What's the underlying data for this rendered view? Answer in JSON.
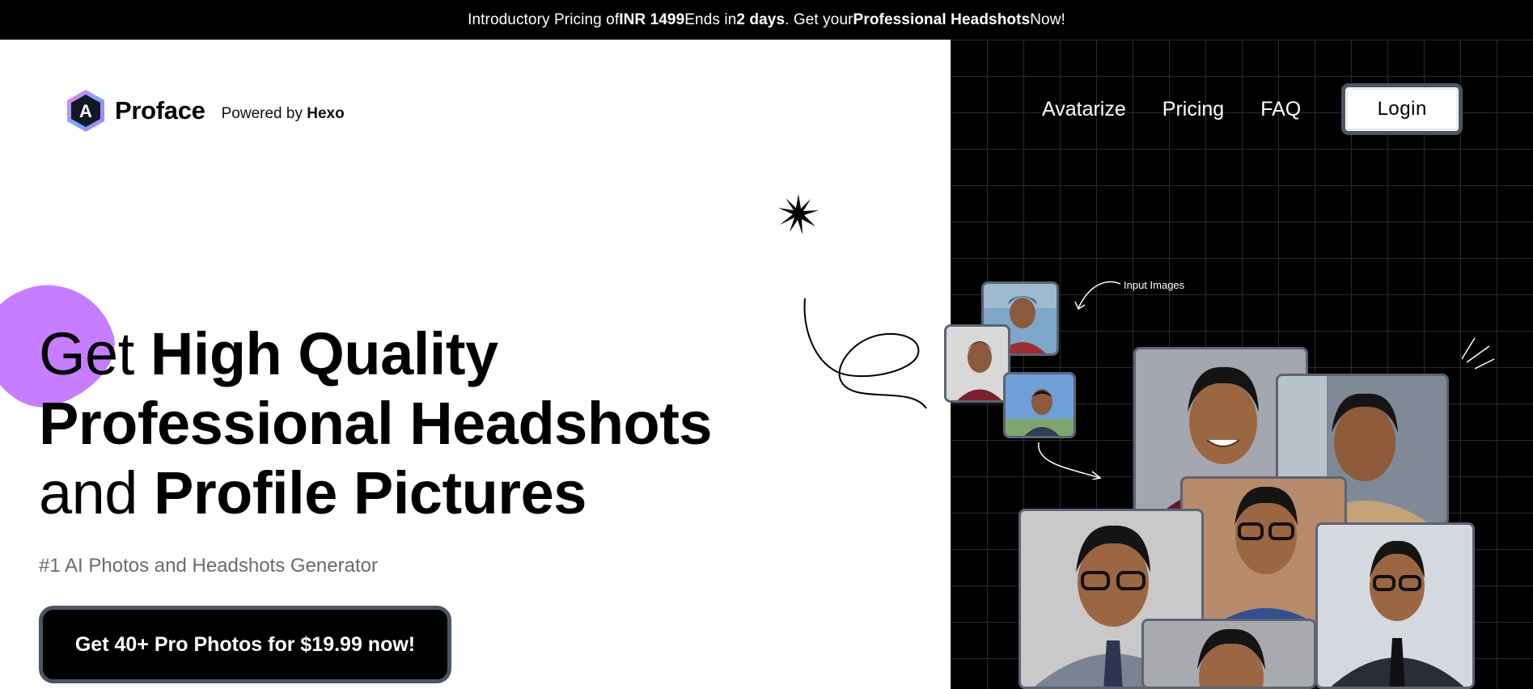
{
  "announcement": {
    "prefix": "Introductory Pricing of ",
    "price": "INR 1499",
    "middle": " Ends in ",
    "days": "2 days",
    "middle2": ". Get your ",
    "product": "Professional Headshots",
    "suffix": " Now!"
  },
  "brand": {
    "logo_letter": "A",
    "name": "Proface",
    "powered_prefix": "Powered by ",
    "powered_name": "Hexo"
  },
  "nav": {
    "items": [
      "Avatarize",
      "Pricing",
      "FAQ"
    ],
    "login_label": "Login"
  },
  "hero": {
    "line1_light": "Get ",
    "line1_bold": "High Quality",
    "line2_bold": "Professional Headshots",
    "line3_light": "and ",
    "line3_bold": "Profile Pictures",
    "subheading": "#1 AI Photos and Headshots Generator",
    "cta_label": "Get 40+ Pro Photos for $19.99 now!"
  },
  "showcase": {
    "input_label": "Input Images"
  },
  "colors": {
    "blob": "#c77dff",
    "panel": "#000000",
    "grid": "#2b2b2b",
    "border": "#5b6472"
  }
}
